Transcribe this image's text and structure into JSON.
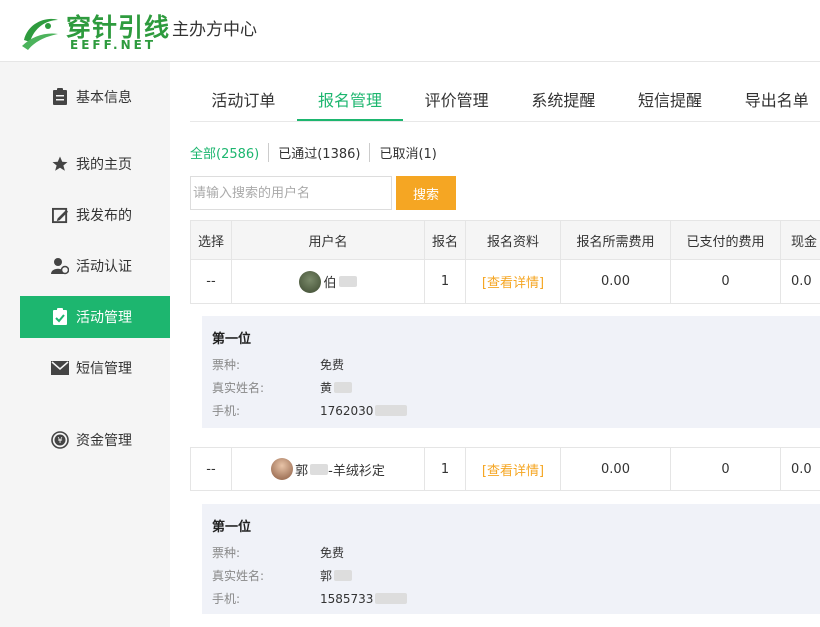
{
  "header": {
    "logo_cn": "穿针引线",
    "logo_en": "EEFF.NET",
    "title": "主办方中心",
    "brand_color": "#2e9b3e"
  },
  "sidebar": {
    "items": [
      {
        "label": "基本信息",
        "icon": "clipboard-icon"
      },
      {
        "label": "我的主页",
        "icon": "star-icon"
      },
      {
        "label": "我发布的",
        "icon": "edit-icon"
      },
      {
        "label": "活动认证",
        "icon": "user-verify-icon"
      },
      {
        "label": "活动管理",
        "icon": "clipboard-check-icon",
        "active": true
      },
      {
        "label": "短信管理",
        "icon": "envelope-icon"
      },
      {
        "label": "资金管理",
        "icon": "money-icon"
      }
    ],
    "active_color": "#1db66f"
  },
  "tabs": [
    {
      "label": "活动订单"
    },
    {
      "label": "报名管理",
      "active": true
    },
    {
      "label": "评价管理"
    },
    {
      "label": "系统提醒"
    },
    {
      "label": "短信提醒"
    },
    {
      "label": "导出名单"
    }
  ],
  "filters": [
    {
      "label": "全部(2586)",
      "active": true
    },
    {
      "label": "已通过(1386)"
    },
    {
      "label": "已取消(1)"
    }
  ],
  "search": {
    "placeholder": "请输入搜索的用户名",
    "button_label": "搜索"
  },
  "table": {
    "headers": [
      "选择",
      "用户名",
      "报名",
      "报名资料",
      "报名所需费用",
      "已支付的费用",
      "现金"
    ],
    "rows": [
      {
        "select": "--",
        "username": "伯",
        "count": "1",
        "info_link": "[查看详情]",
        "fee": "0.00",
        "paid": "0",
        "cash": "0.0",
        "detail": {
          "title": "第一位",
          "ticket_label": "票种:",
          "ticket_value": "免费",
          "name_label": "真实姓名:",
          "name_value": "黄",
          "phone_label": "手机:",
          "phone_value": "1762030"
        }
      },
      {
        "select": "--",
        "username_prefix": "郭",
        "username_suffix": "-羊绒衫定",
        "count": "1",
        "info_link": "[查看详情]",
        "fee": "0.00",
        "paid": "0",
        "cash": "0.0",
        "detail": {
          "title": "第一位",
          "ticket_label": "票种:",
          "ticket_value": "免费",
          "name_label": "真实姓名:",
          "name_value": "郭",
          "phone_label": "手机:",
          "phone_value": "1585733"
        }
      }
    ]
  }
}
